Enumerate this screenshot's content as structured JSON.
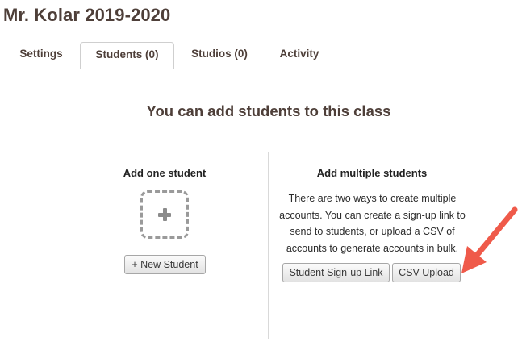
{
  "class_title": "Mr. Kolar 2019-2020",
  "tabs": [
    {
      "label": "Settings",
      "active": false
    },
    {
      "label": "Students (0)",
      "active": true
    },
    {
      "label": "Studios (0)",
      "active": false
    },
    {
      "label": "Activity",
      "active": false
    }
  ],
  "main": {
    "heading": "You can add students to this class",
    "single": {
      "title": "Add one student",
      "add_icon": "plus-icon",
      "button_label": "+ New Student"
    },
    "multiple": {
      "title": "Add multiple students",
      "description": "There are two ways to create multiple accounts. You can create a sign-up link to send to students, or upload a CSV of accounts to generate accounts in bulk.",
      "signup_button_label": "Student Sign-up Link",
      "csv_button_label": "CSV Upload"
    }
  },
  "annotation": {
    "arrow_color": "#ef5a4a",
    "arrow_icon": "arrow-pointer-icon"
  }
}
